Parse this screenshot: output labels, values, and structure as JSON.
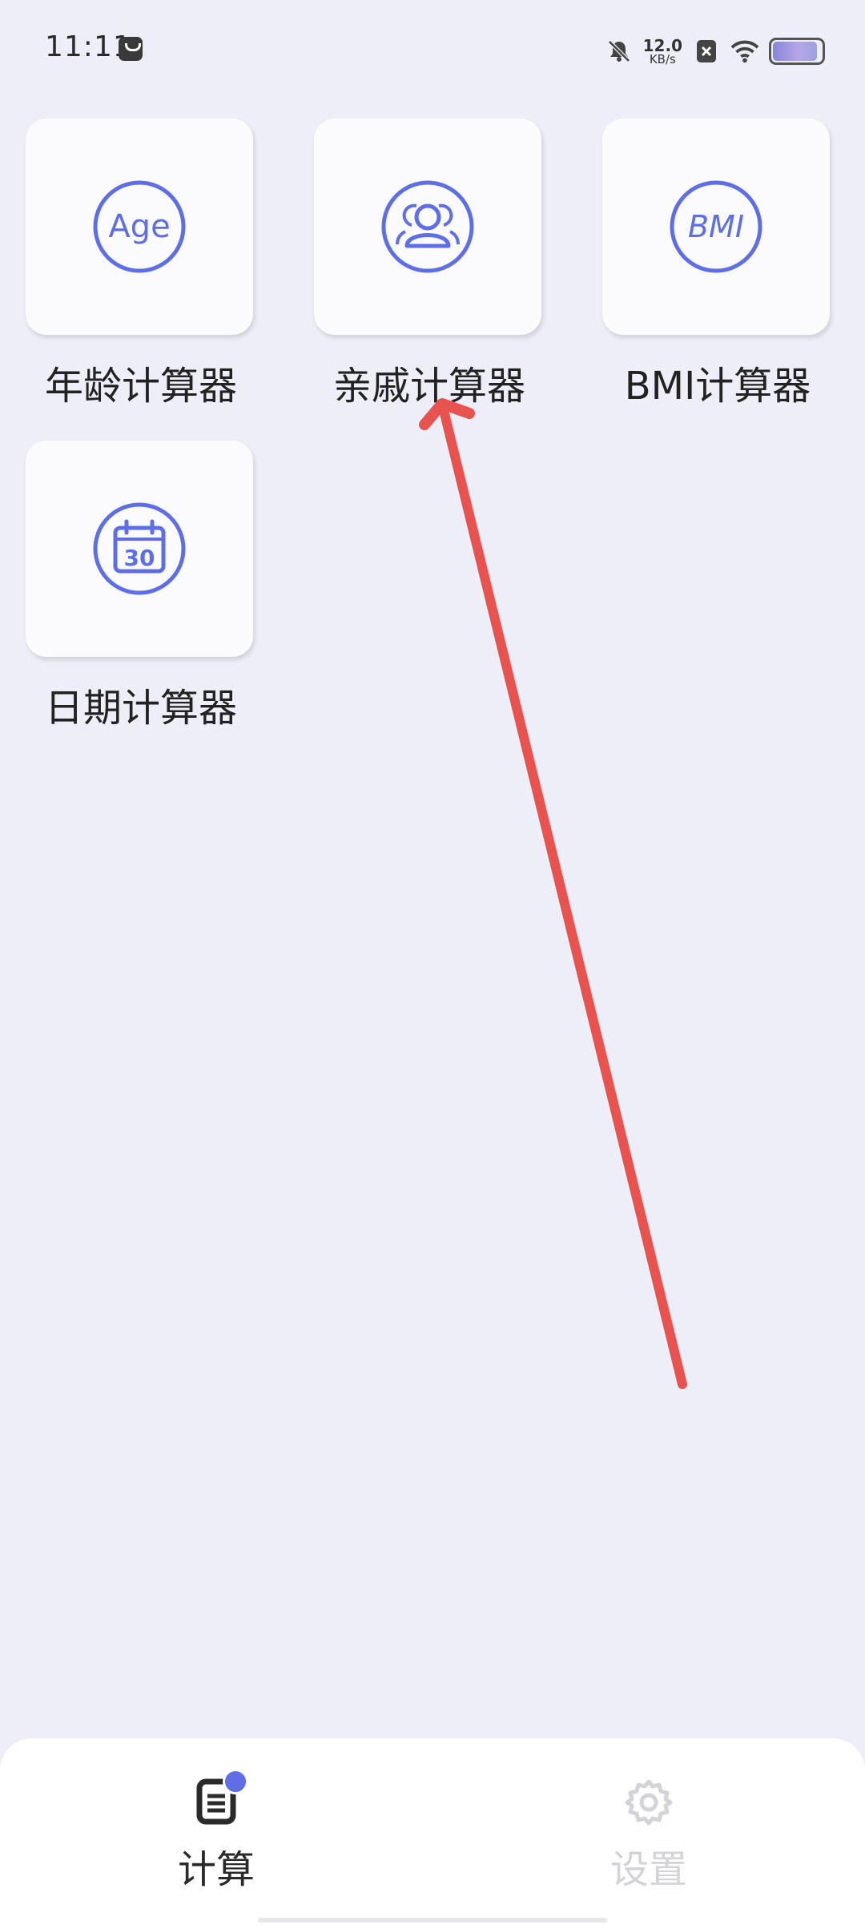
{
  "status_bar": {
    "time": "11:11",
    "net_speed_value": "12.0",
    "net_speed_unit": "KB/s",
    "battery_level": 0.92,
    "icons": [
      "notification-icon",
      "mute-bell-icon",
      "close-box-icon",
      "wifi-icon",
      "battery-icon"
    ]
  },
  "calculators": [
    {
      "label": "年龄计算器",
      "icon": "age-icon",
      "icon_text": "Age"
    },
    {
      "label": "亲戚计算器",
      "icon": "relatives-icon"
    },
    {
      "label": "BMI计算器",
      "icon": "bmi-icon",
      "icon_text": "BMI"
    },
    {
      "label": "日期计算器",
      "icon": "calendar-icon",
      "icon_text": "30"
    }
  ],
  "bottom_nav": {
    "items": [
      {
        "label": "计算",
        "icon": "document-icon",
        "active": true
      },
      {
        "label": "设置",
        "icon": "gear-icon",
        "active": false
      }
    ]
  },
  "colors": {
    "accent": "#5d6ee6",
    "background": "#eeeef8",
    "annotation": "#e8524f"
  }
}
